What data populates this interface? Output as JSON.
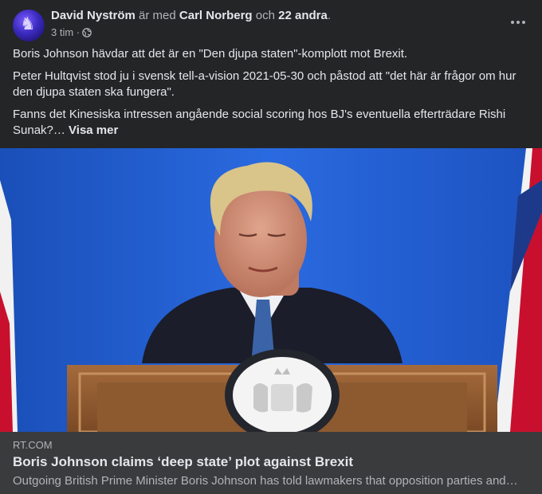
{
  "post": {
    "author": "David Nyström",
    "with_text": "är med",
    "tagged": "Carl Norberg",
    "and_text": "och",
    "others": "22 andra",
    "period": ".",
    "time": "3 tim",
    "separator": "·",
    "privacy_icon": "globe-icon",
    "paragraphs": [
      "Boris Johnson hävdar att det är en \"Den djupa staten\"-komplott mot Brexit.",
      "Peter Hultqvist stod ju i svensk tell-a-vision 2021-05-30 och påstod att \"det här är frågor om hur den djupa  staten ska fungera\".",
      "Fanns det Kinesiska intressen angående social scoring hos BJ's eventuella efterträdare Rishi Sunak?…"
    ],
    "see_more": "Visa mer"
  },
  "link": {
    "domain": "RT.COM",
    "title": "Boris Johnson claims ‘deep state’ plot against Brexit",
    "description": "Outgoing British Prime Minister Boris Johnson has told lawmakers that opposition parties and…"
  },
  "colors": {
    "background": "#242526",
    "preview_background": "#3a3b3c",
    "primary_text": "#e4e6eb",
    "secondary_text": "#b0b3b8"
  }
}
